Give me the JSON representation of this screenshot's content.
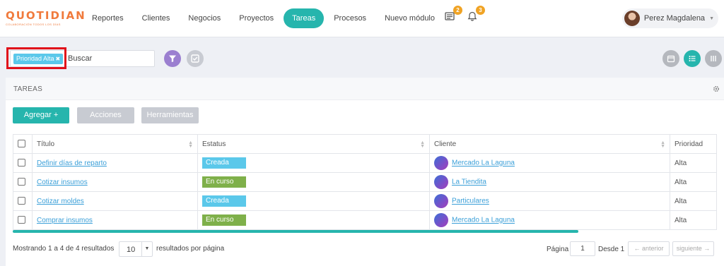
{
  "logo": {
    "main": "QUOTIDIAN",
    "sub": "COLABORACIÓN TODOS LOS DÍAS"
  },
  "nav": {
    "items": [
      {
        "label": "Reportes",
        "active": false
      },
      {
        "label": "Clientes",
        "active": false
      },
      {
        "label": "Negocios",
        "active": false
      },
      {
        "label": "Proyectos",
        "active": false
      },
      {
        "label": "Tareas",
        "active": true
      },
      {
        "label": "Procesos",
        "active": false
      },
      {
        "label": "Nuevo módulo",
        "active": false
      }
    ],
    "messages_badge": "2",
    "notifications_badge": "3",
    "user_name": "Perez Magdalena"
  },
  "filter": {
    "chip_label": "Prioridad Alta",
    "search_placeholder": "Buscar"
  },
  "panel": {
    "title": "TAREAS",
    "buttons": {
      "add": "Agregar +",
      "actions": "Acciones",
      "tools": "Herramientas"
    }
  },
  "table": {
    "columns": [
      "Título",
      "Estatus",
      "Cliente",
      "Prioridad"
    ],
    "rows": [
      {
        "title": "Definir días de reparto",
        "status": "Creada",
        "client": "Mercado La Laguna",
        "priority": "Alta"
      },
      {
        "title": "Cotizar insumos",
        "status": "En curso",
        "client": "La Tiendita",
        "priority": "Alta"
      },
      {
        "title": "Cotizar moldes",
        "status": "Creada",
        "client": "Particulares",
        "priority": "Alta"
      },
      {
        "title": "Comprar insumos",
        "status": "En curso",
        "client": "Mercado La Laguna",
        "priority": "Alta"
      }
    ]
  },
  "footer": {
    "showing": "Mostrando 1 a 4 de 4 resultados",
    "page_size": "10",
    "per_page_label": "resultados por página",
    "page_label": "Página",
    "page_value": "1",
    "of_label": "Desde 1",
    "prev": "← anterior",
    "next": "siguiente →"
  },
  "colors": {
    "brand_orange": "#f07a3c",
    "accent_teal": "#26b5ad",
    "status_created": "#5bc8ea",
    "status_in_progress": "#7fb04a",
    "filter_purple": "#9b7fd0",
    "button_gray": "#c8cbd2",
    "highlight_red": "#e0101a"
  }
}
